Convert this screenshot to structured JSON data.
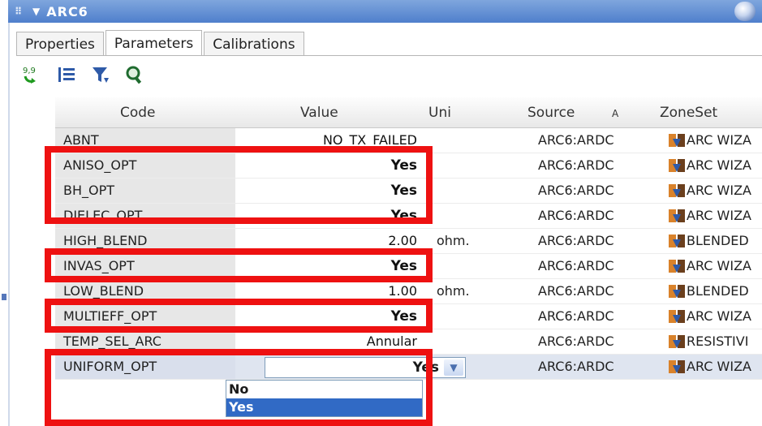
{
  "window": {
    "title": "ARC6"
  },
  "tabs": [
    {
      "label": "Properties"
    },
    {
      "label": "Parameters"
    },
    {
      "label": "Calibrations"
    }
  ],
  "toolbar": {
    "icons": [
      "refresh-icon",
      "sort-list-icon",
      "filter-icon",
      "search-icon"
    ],
    "refresh_glyph": "9,9"
  },
  "columns": {
    "code": "Code",
    "value": "Value",
    "unit": "Uni",
    "source": "Source",
    "sort": "A",
    "zoneset": "ZoneSet"
  },
  "rows": [
    {
      "code": "ABNT",
      "value": "NO_TX_FAILED",
      "unit": "",
      "source": "ARC6:ARDC",
      "zone": "ARC WIZA",
      "bold": false
    },
    {
      "code": "ANISO_OPT",
      "value": "Yes",
      "unit": "",
      "source": "ARC6:ARDC",
      "zone": "ARC WIZA",
      "bold": true
    },
    {
      "code": "BH_OPT",
      "value": "Yes",
      "unit": "",
      "source": "ARC6:ARDC",
      "zone": "ARC WIZA",
      "bold": true
    },
    {
      "code": "DIELEC_OPT",
      "value": "Yes",
      "unit": "",
      "source": "ARC6:ARDC",
      "zone": "ARC WIZA",
      "bold": true
    },
    {
      "code": "HIGH_BLEND",
      "value": "2.00",
      "unit": "ohm.",
      "source": "ARC6:ARDC",
      "zone": "BLENDED",
      "bold": false
    },
    {
      "code": "INVAS_OPT",
      "value": "Yes",
      "unit": "",
      "source": "ARC6:ARDC",
      "zone": "ARC WIZA",
      "bold": true
    },
    {
      "code": "LOW_BLEND",
      "value": "1.00",
      "unit": "ohm.",
      "source": "ARC6:ARDC",
      "zone": "BLENDED",
      "bold": false
    },
    {
      "code": "MULTIEFF_OPT",
      "value": "Yes",
      "unit": "",
      "source": "ARC6:ARDC",
      "zone": "ARC WIZA",
      "bold": true
    },
    {
      "code": "TEMP_SEL_ARC",
      "value": "Annular",
      "unit": "",
      "source": "ARC6:ARDC",
      "zone": "RESISTIVI",
      "bold": false
    },
    {
      "code": "UNIFORM_OPT",
      "value": "Yes",
      "unit": "",
      "source": "ARC6:ARDC",
      "zone": "ARC WIZA",
      "bold": true
    }
  ],
  "dropdown": {
    "selected": "Yes",
    "options": [
      "No",
      "Yes"
    ]
  },
  "colors": {
    "highlight": "#ee1111",
    "selection": "#316ac5",
    "titlebar": "#4f7fcc"
  }
}
